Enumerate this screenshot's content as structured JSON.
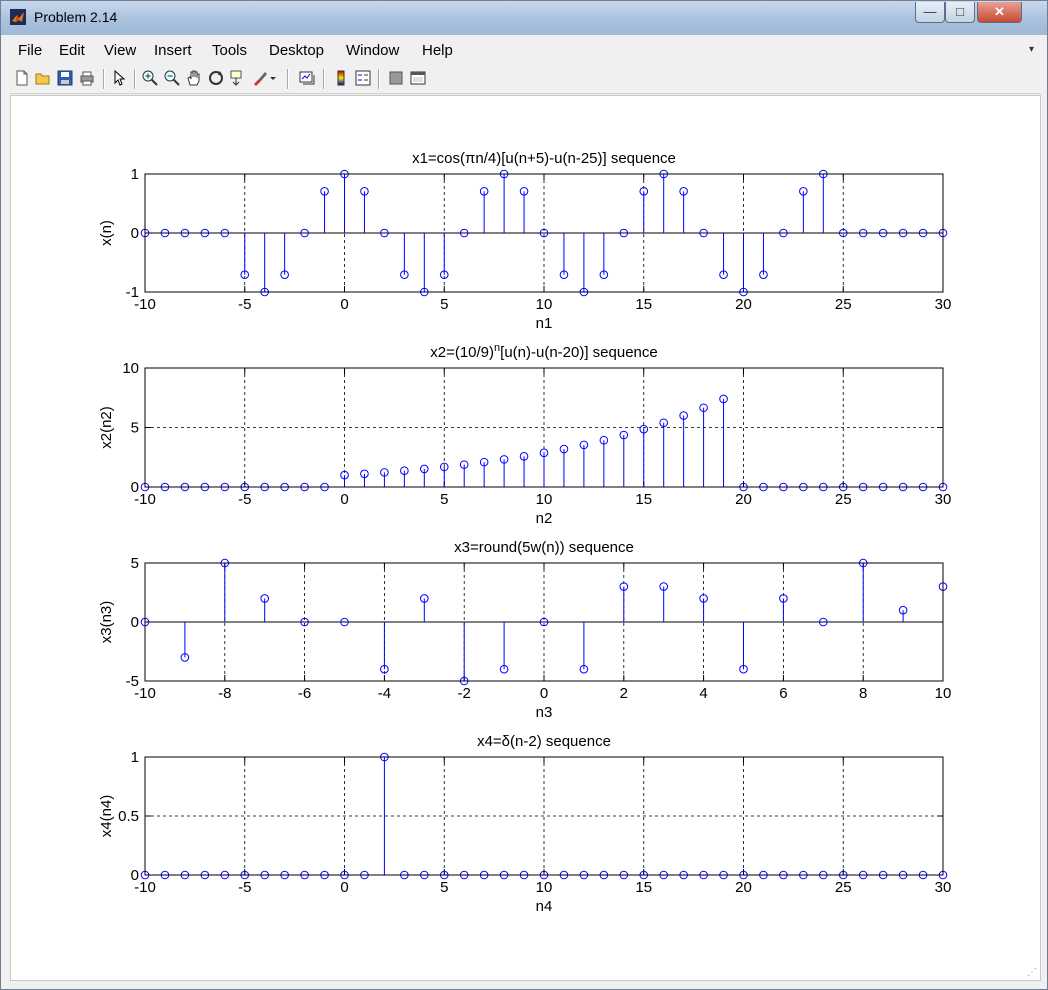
{
  "window": {
    "title": "Problem 2.14",
    "minimize_glyph": "—",
    "maximize_glyph": "□",
    "close_glyph": "✕"
  },
  "menu": {
    "items": [
      "File",
      "Edit",
      "View",
      "Insert",
      "Tools",
      "Desktop",
      "Window",
      "Help"
    ],
    "overflow_glyph": "▾"
  },
  "toolbar": {
    "icons": [
      "new-figure-icon",
      "open-file-icon",
      "save-icon",
      "print-icon",
      "edit-plot-arrow-icon",
      "zoom-in-icon",
      "zoom-out-icon",
      "pan-hand-icon",
      "rotate-3d-icon",
      "data-cursor-icon",
      "brush-icon",
      "brush-dropdown-icon",
      "link-plot-icon",
      "insert-colorbar-icon",
      "insert-legend-icon",
      "hide-plot-tools-icon",
      "show-plot-tools-icon"
    ]
  },
  "colors": {
    "stem": "#0000ff",
    "axes": "#000000",
    "grid": "#000000",
    "figure_bg": "#ffffff",
    "window_chrome": "#f0f0f0"
  },
  "chart_data": [
    {
      "type": "stem",
      "title": "x1=cos(πn/4)[u(n+5)-u(n-25)] sequence",
      "xlabel": "n1",
      "ylabel": "x(n)",
      "xlim": [
        -10,
        30
      ],
      "ylim": [
        -1,
        1
      ],
      "xticks": [
        -10,
        -5,
        0,
        5,
        10,
        15,
        20,
        25,
        30
      ],
      "yticks": [
        -1,
        0,
        1
      ],
      "grid": true,
      "x": [
        -10,
        -9,
        -8,
        -7,
        -6,
        -5,
        -4,
        -3,
        -2,
        -1,
        0,
        1,
        2,
        3,
        4,
        5,
        6,
        7,
        8,
        9,
        10,
        11,
        12,
        13,
        14,
        15,
        16,
        17,
        18,
        19,
        20,
        21,
        22,
        23,
        24,
        25,
        26,
        27,
        28,
        29,
        30
      ],
      "values": [
        0,
        0,
        0,
        0,
        0,
        -0.707,
        -1,
        -0.707,
        0,
        0.707,
        1,
        0.707,
        0,
        -0.707,
        -1,
        -0.707,
        0,
        0.707,
        1,
        0.707,
        0,
        -0.707,
        -1,
        -0.707,
        0,
        0.707,
        1,
        0.707,
        0,
        -0.707,
        -1,
        -0.707,
        0,
        0.707,
        1,
        0,
        0,
        0,
        0,
        0,
        0
      ]
    },
    {
      "type": "stem",
      "title": "x2=(10/9)",
      "title_superscript": "n",
      "title_suffix": "[u(n)-u(n-20)] sequence",
      "xlabel": "n2",
      "ylabel": "x2(n2)",
      "xlim": [
        -10,
        30
      ],
      "ylim": [
        0,
        10
      ],
      "xticks": [
        -10,
        -5,
        0,
        5,
        10,
        15,
        20,
        25,
        30
      ],
      "yticks": [
        0,
        5,
        10
      ],
      "grid": true,
      "x": [
        -10,
        -9,
        -8,
        -7,
        -6,
        -5,
        -4,
        -3,
        -2,
        -1,
        0,
        1,
        2,
        3,
        4,
        5,
        6,
        7,
        8,
        9,
        10,
        11,
        12,
        13,
        14,
        15,
        16,
        17,
        18,
        19,
        20,
        21,
        22,
        23,
        24,
        25,
        26,
        27,
        28,
        29,
        30
      ],
      "values": [
        0,
        0,
        0,
        0,
        0,
        0,
        0,
        0,
        0,
        0,
        1,
        1.11,
        1.23,
        1.37,
        1.52,
        1.69,
        1.88,
        2.09,
        2.32,
        2.58,
        2.87,
        3.19,
        3.54,
        3.93,
        4.37,
        4.86,
        5.4,
        6.0,
        6.66,
        7.4,
        0,
        0,
        0,
        0,
        0,
        0,
        0,
        0,
        0,
        0,
        0
      ]
    },
    {
      "type": "stem",
      "title": "x3=round(5w(n)) sequence",
      "xlabel": "n3",
      "ylabel": "x3(n3)",
      "xlim": [
        -10,
        10
      ],
      "ylim": [
        -5,
        5
      ],
      "xticks": [
        -10,
        -8,
        -6,
        -4,
        -2,
        0,
        2,
        4,
        6,
        8,
        10
      ],
      "yticks": [
        -5,
        0,
        5
      ],
      "grid": true,
      "x": [
        -10,
        -9,
        -8,
        -7,
        -6,
        -5,
        -4,
        -3,
        -2,
        -1,
        0,
        1,
        2,
        3,
        4,
        5,
        6,
        7,
        8,
        9,
        10
      ],
      "values": [
        0,
        -3,
        5,
        2,
        0,
        0,
        -4,
        2,
        -5,
        -4,
        0,
        -4,
        3,
        3,
        2,
        -4,
        2,
        0,
        5,
        1,
        3
      ]
    },
    {
      "type": "stem",
      "title": "x4=δ(n-2) sequence",
      "xlabel": "n4",
      "ylabel": "x4(n4)",
      "xlim": [
        -10,
        30
      ],
      "ylim": [
        0,
        1
      ],
      "xticks": [
        -10,
        -5,
        0,
        5,
        10,
        15,
        20,
        25,
        30
      ],
      "yticks": [
        0,
        0.5,
        1
      ],
      "grid": true,
      "x": [
        -10,
        -9,
        -8,
        -7,
        -6,
        -5,
        -4,
        -3,
        -2,
        -1,
        0,
        1,
        2,
        3,
        4,
        5,
        6,
        7,
        8,
        9,
        10,
        11,
        12,
        13,
        14,
        15,
        16,
        17,
        18,
        19,
        20,
        21,
        22,
        23,
        24,
        25,
        26,
        27,
        28,
        29,
        30
      ],
      "values": [
        0,
        0,
        0,
        0,
        0,
        0,
        0,
        0,
        0,
        0,
        0,
        0,
        1,
        0,
        0,
        0,
        0,
        0,
        0,
        0,
        0,
        0,
        0,
        0,
        0,
        0,
        0,
        0,
        0,
        0,
        0,
        0,
        0,
        0,
        0,
        0,
        0,
        0,
        0,
        0,
        0
      ]
    }
  ]
}
